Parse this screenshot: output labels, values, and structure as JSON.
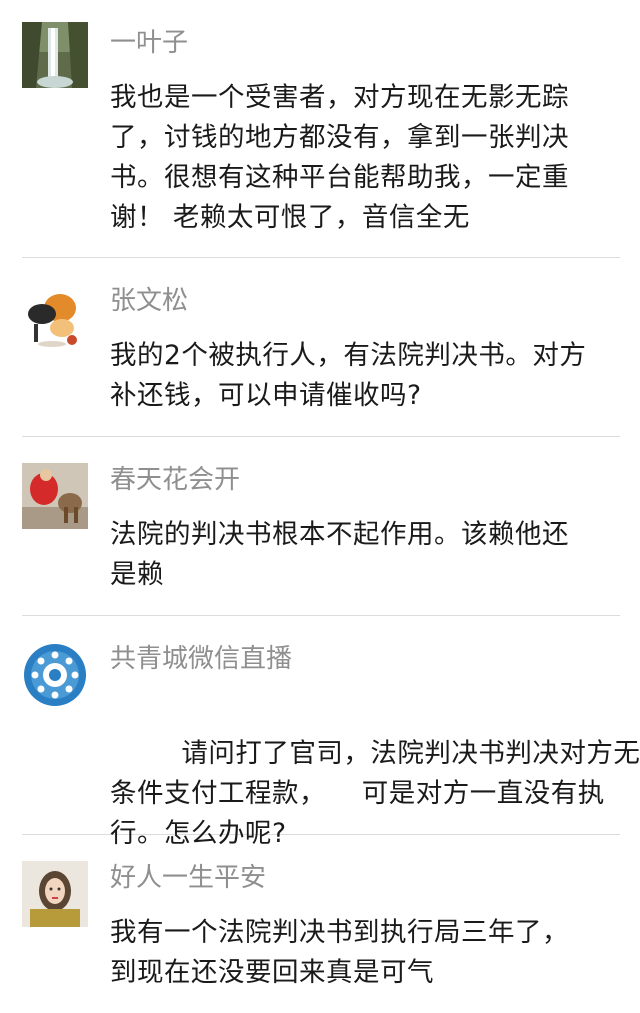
{
  "comments": [
    {
      "name": "一叶子",
      "lines": [
        "我也是一个受害者，对方现在无影无踪",
        "了，讨钱的地方都没有，拿到一张判决",
        "书。很想有这种平台能帮助我，一定重",
        "谢！ 老赖太可恨了，音信全无"
      ]
    },
    {
      "name": "张文松",
      "lines": [
        "我的2个被执行人，有法院判决书。对方",
        "补还钱，可以申请催收吗?"
      ]
    },
    {
      "name": "春天花会开",
      "lines": [
        "法院的判决书根本不起作用。该赖他还",
        "是赖"
      ]
    },
    {
      "name": "共青城微信直播",
      "lines": [
        "请问打了官司，法院判决书判决对方无",
        "条件支付工程款，    可是对方一直没有执",
        "行。怎么办呢?"
      ]
    },
    {
      "name": "好人一生平安",
      "lines": [
        "我有一个法院判决书到执行局三年了，",
        "到现在还没要回来真是可气"
      ]
    }
  ]
}
